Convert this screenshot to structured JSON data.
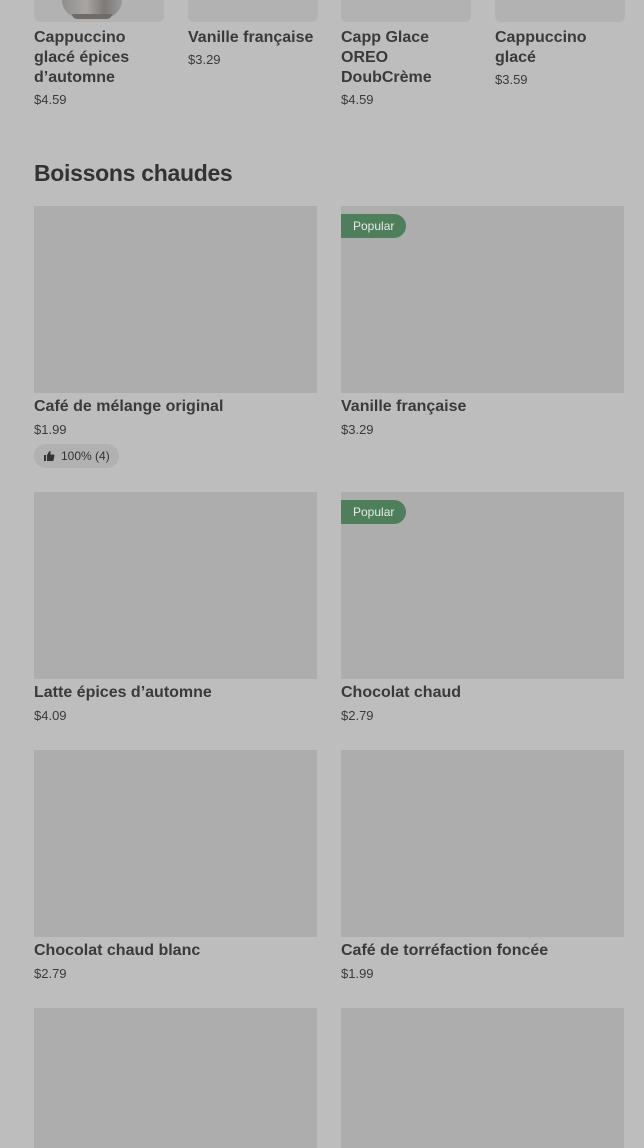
{
  "top_row": [
    {
      "name": "Cappuccino glacé épices d’automne",
      "lines": [
        "Cappuccino",
        "glacé épices",
        "d’automne"
      ],
      "price": "$4.59"
    },
    {
      "name": "Vanille française",
      "lines": [
        "Vanille française"
      ],
      "price": "$3.29"
    },
    {
      "name": "Capp Glace OREO DoubCrème",
      "lines": [
        "Capp Glace",
        "OREO",
        "DoubCrème"
      ],
      "price": "$4.59"
    },
    {
      "name": "Cappuccino glacé",
      "lines": [
        "Cappuccino",
        "glacé"
      ],
      "price": "$3.59"
    }
  ],
  "section": {
    "title": "Boissons chaudes",
    "items": [
      {
        "name": "Café de mélange original",
        "price": "$1.99",
        "badge": "",
        "rating": "100% (4)"
      },
      {
        "name": "Vanille française",
        "price": "$3.29",
        "badge": "Popular",
        "rating": ""
      },
      {
        "name": "Latte épices d’automne",
        "price": "$4.09",
        "badge": "",
        "rating": ""
      },
      {
        "name": "Chocolat chaud",
        "price": "$2.79",
        "badge": "Popular",
        "rating": ""
      },
      {
        "name": "Chocolat chaud blanc",
        "price": "$2.79",
        "badge": "",
        "rating": ""
      },
      {
        "name": "Café de torréfaction foncée",
        "price": "$1.99",
        "badge": "",
        "rating": ""
      },
      {
        "name": "",
        "price": "",
        "badge": "",
        "rating": ""
      },
      {
        "name": "",
        "price": "",
        "badge": "",
        "rating": ""
      }
    ]
  },
  "colors": {
    "badge_bg": "#4d7f5a",
    "overlay": "#bdbdbd"
  },
  "icons": {
    "rating": "thumbs-up-icon"
  }
}
